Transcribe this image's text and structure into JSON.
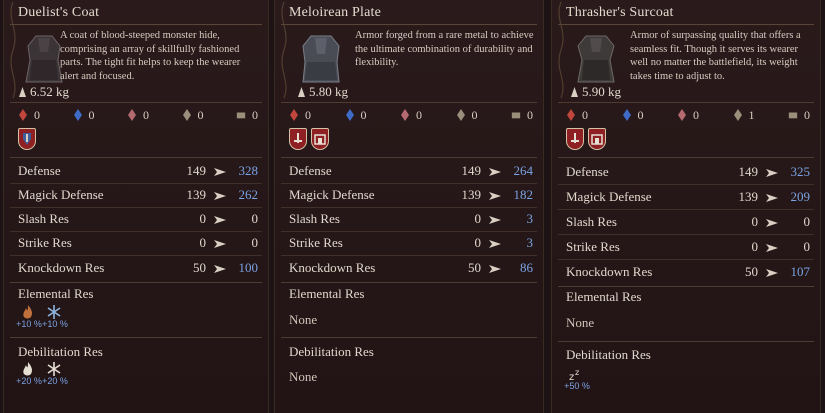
{
  "panels": [
    {
      "name": "Duelist's Coat",
      "weight": "6.52 kg",
      "description": "A coat of blood-steeped monster hide, comprising an array of skillfully fashioned parts. The tight fit helps to keep the wearer alert and focused.",
      "counts": [
        "0",
        "0",
        "0",
        "0",
        "0"
      ],
      "stats": [
        {
          "label": "Defense",
          "current": "149",
          "new": "328"
        },
        {
          "label": "Magick Defense",
          "current": "139",
          "new": "262"
        },
        {
          "label": "Slash Res",
          "current": "0",
          "new": "0"
        },
        {
          "label": "Strike Res",
          "current": "0",
          "new": "0"
        },
        {
          "label": "Knockdown Res",
          "current": "50",
          "new": "100"
        }
      ],
      "elemental_title": "Elemental Res",
      "elemental": [
        {
          "icon": "fire-icon",
          "value": "+10 %"
        },
        {
          "icon": "ice-icon",
          "value": "+10 %"
        }
      ],
      "debilitation_title": "Debilitation Res",
      "debilitation": [
        {
          "icon": "burn-icon",
          "value": "+20 %"
        },
        {
          "icon": "frozen-icon",
          "value": "+20 %"
        }
      ]
    },
    {
      "name": "Meloirean Plate",
      "weight": "5.80 kg",
      "description": "Armor forged from a rare metal to achieve the ultimate combination of durability and flexibility.",
      "counts": [
        "0",
        "0",
        "0",
        "0",
        "0"
      ],
      "stats": [
        {
          "label": "Defense",
          "current": "149",
          "new": "264"
        },
        {
          "label": "Magick Defense",
          "current": "139",
          "new": "182"
        },
        {
          "label": "Slash Res",
          "current": "0",
          "new": "3"
        },
        {
          "label": "Strike Res",
          "current": "0",
          "new": "3"
        },
        {
          "label": "Knockdown Res",
          "current": "50",
          "new": "86"
        }
      ],
      "elemental_title": "Elemental Res",
      "elemental_none": "None",
      "debilitation_title": "Debilitation Res",
      "debilitation_none": "None"
    },
    {
      "name": "Thrasher's Surcoat",
      "weight": "5.90 kg",
      "description": "Armor of surpassing quality that offers a seamless fit. Though it serves its wearer well no matter the battlefield, its weight takes time to adjust to.",
      "counts": [
        "0",
        "0",
        "0",
        "1",
        "0"
      ],
      "stats": [
        {
          "label": "Defense",
          "current": "149",
          "new": "325"
        },
        {
          "label": "Magick Defense",
          "current": "139",
          "new": "209"
        },
        {
          "label": "Slash Res",
          "current": "0",
          "new": "0"
        },
        {
          "label": "Strike Res",
          "current": "0",
          "new": "0"
        },
        {
          "label": "Knockdown Res",
          "current": "50",
          "new": "107"
        }
      ],
      "elemental_title": "Elemental Res",
      "elemental_none": "None",
      "debilitation_title": "Debilitation Res",
      "debilitation": [
        {
          "icon": "sleep-icon",
          "value": "+50 %"
        }
      ]
    }
  ],
  "colors": {
    "improved": "#7aa3e3",
    "badge": "#8e1f22"
  }
}
